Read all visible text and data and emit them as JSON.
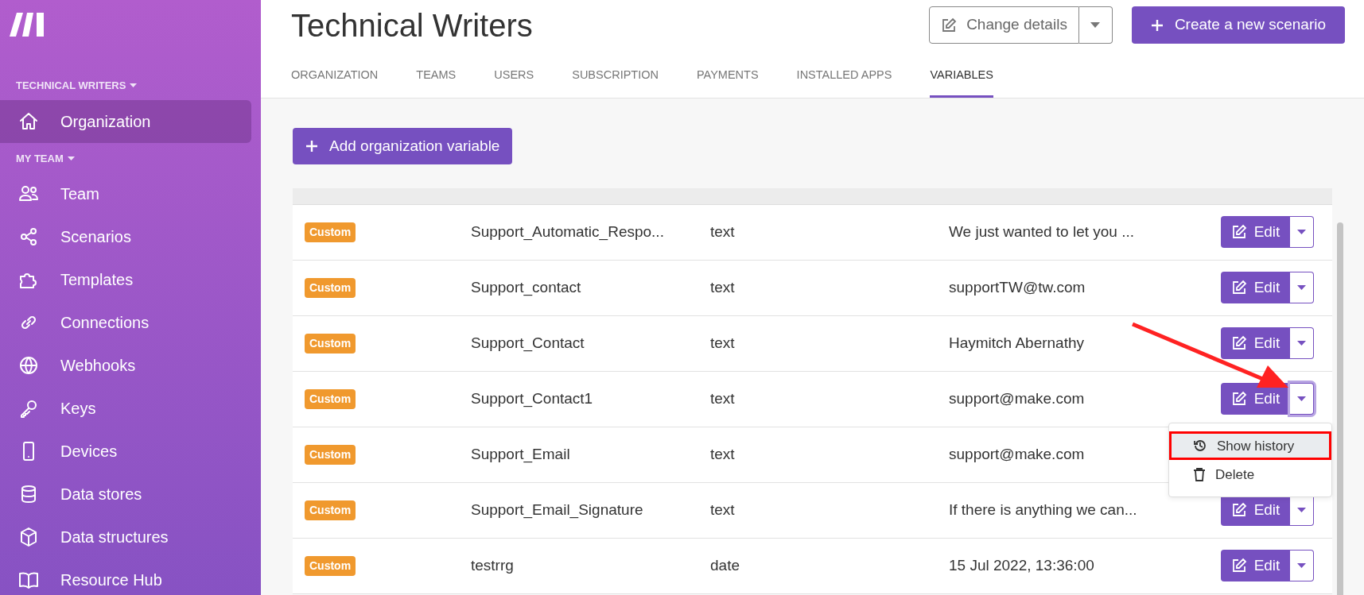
{
  "sidebar": {
    "sections": [
      {
        "label": "TECHNICAL WRITERS",
        "items": [
          {
            "label": "Organization",
            "selected": true
          }
        ]
      },
      {
        "label": "MY TEAM",
        "items": [
          {
            "label": "Team",
            "selected": false
          },
          {
            "label": "Scenarios",
            "selected": false
          },
          {
            "label": "Templates",
            "selected": false
          },
          {
            "label": "Connections",
            "selected": false
          },
          {
            "label": "Webhooks",
            "selected": false
          },
          {
            "label": "Keys",
            "selected": false
          },
          {
            "label": "Devices",
            "selected": false
          },
          {
            "label": "Data stores",
            "selected": false
          },
          {
            "label": "Data structures",
            "selected": false
          },
          {
            "label": "Resource Hub",
            "selected": false
          }
        ]
      }
    ]
  },
  "header": {
    "title": "Technical Writers",
    "change_button": "Change details",
    "create_button": "Create a new scenario"
  },
  "tabs": [
    {
      "label": "ORGANIZATION",
      "selected": false
    },
    {
      "label": "TEAMS",
      "selected": false
    },
    {
      "label": "USERS",
      "selected": false
    },
    {
      "label": "SUBSCRIPTION",
      "selected": false
    },
    {
      "label": "PAYMENTS",
      "selected": false
    },
    {
      "label": "INSTALLED APPS",
      "selected": false
    },
    {
      "label": "VARIABLES",
      "selected": true
    }
  ],
  "add_button": "Add organization variable",
  "table": {
    "rows": [
      {
        "badge": "Custom",
        "name": "Support_Automatic_Respo...",
        "type": "text",
        "value": "We just wanted to let you ...",
        "action": "Edit",
        "menu_open": false
      },
      {
        "badge": "Custom",
        "name": "Support_contact",
        "type": "text",
        "value": "supportTW@tw.com",
        "action": "Edit",
        "menu_open": false
      },
      {
        "badge": "Custom",
        "name": "Support_Contact",
        "type": "text",
        "value": "Haymitch Abernathy",
        "action": "Edit",
        "menu_open": false
      },
      {
        "badge": "Custom",
        "name": "Support_Contact1",
        "type": "text",
        "value": "support@make.com",
        "action": "Edit",
        "menu_open": true
      },
      {
        "badge": "Custom",
        "name": "Support_Email",
        "type": "text",
        "value": "support@make.com"
      },
      {
        "badge": "Custom",
        "name": "Support_Email_Signature",
        "type": "text",
        "value": "If there is anything we can...",
        "action": "Edit",
        "menu_open": false
      },
      {
        "badge": "Custom",
        "name": "testrrg",
        "type": "date",
        "value": "15 Jul 2022, 13:36:00",
        "action": "Edit",
        "menu_open": false
      }
    ]
  },
  "row_menu": {
    "items": [
      {
        "label": "Show history",
        "selected": true,
        "annotated": true
      },
      {
        "label": "Delete",
        "selected": false,
        "annotated": false
      }
    ]
  }
}
